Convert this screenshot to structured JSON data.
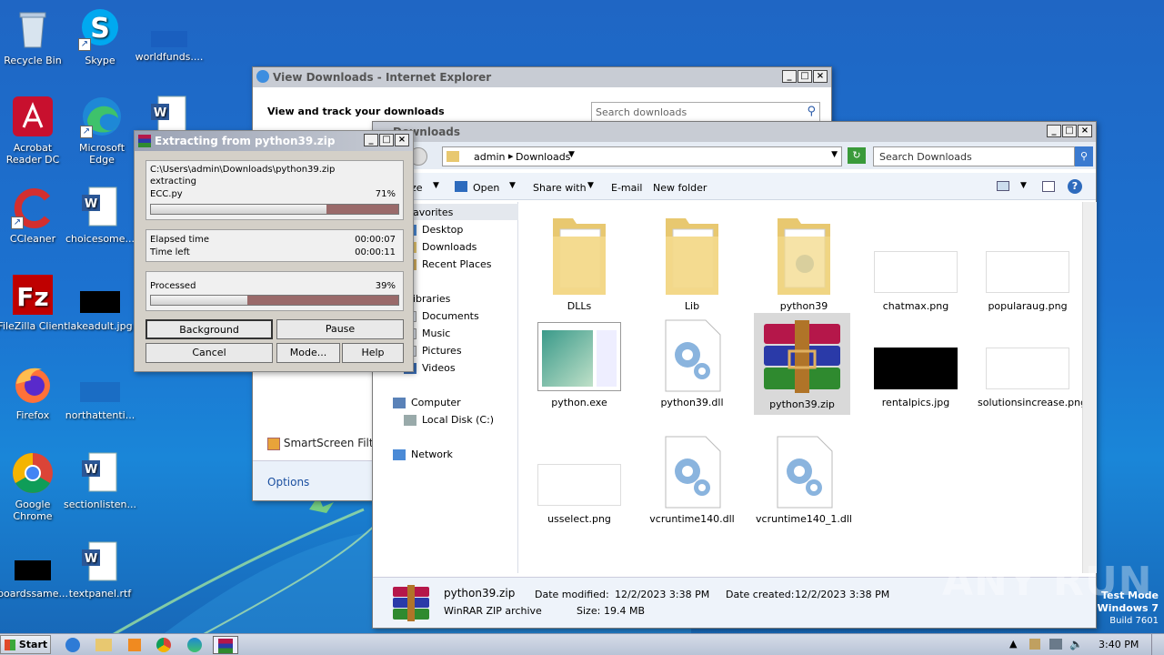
{
  "desktop": {
    "icons": [
      {
        "label": "Recycle Bin"
      },
      {
        "label": "Skype"
      },
      {
        "label": "worldfunds...."
      },
      {
        "label": "Acrobat Reader DC"
      },
      {
        "label": "Microsoft Edge"
      },
      {
        "label": "CCleaner"
      },
      {
        "label": "choicesome..."
      },
      {
        "label": "FileZilla Client"
      },
      {
        "label": "lakeadult.jpg"
      },
      {
        "label": "Firefox"
      },
      {
        "label": "northattenti..."
      },
      {
        "label": "Google Chrome"
      },
      {
        "label": "sectionlisten..."
      },
      {
        "label": "boardssame..."
      },
      {
        "label": "textpanel.rtf"
      }
    ]
  },
  "ie_window": {
    "title": "View Downloads - Internet Explorer",
    "heading": "View and track your downloads",
    "search_placeholder": "Search downloads",
    "smartscreen": "SmartScreen Filte",
    "options": "Options"
  },
  "explorer": {
    "title": "Downloads",
    "breadcrumb": [
      "admin",
      "Downloads"
    ],
    "search_placeholder": "Search Downloads",
    "toolbar": {
      "organize": "ze",
      "open": "Open",
      "share": "Share with",
      "email": "E-mail",
      "new_folder": "New folder"
    },
    "nav": {
      "favorites": "avorites",
      "desktop": "Desktop",
      "downloads": "Downloads",
      "recent": "Recent Places",
      "libraries": "ibraries",
      "documents": "Documents",
      "music": "Music",
      "pictures": "Pictures",
      "videos": "Videos",
      "computer": "Computer",
      "localdisk": "Local Disk (C:)",
      "network": "Network"
    },
    "files": [
      {
        "name": "DLLs"
      },
      {
        "name": "Lib"
      },
      {
        "name": "python39"
      },
      {
        "name": "chatmax.png"
      },
      {
        "name": "popularaug.png"
      },
      {
        "name": "python.exe"
      },
      {
        "name": "python39.dll"
      },
      {
        "name": "python39.zip"
      },
      {
        "name": "rentalpics.jpg"
      },
      {
        "name": "solutionsincrease.png"
      },
      {
        "name": "usselect.png"
      },
      {
        "name": "vcruntime140.dll"
      },
      {
        "name": "vcruntime140_1.dll"
      }
    ],
    "details": {
      "name": "python39.zip",
      "type": "WinRAR ZIP archive",
      "modified_label": "Date modified:",
      "modified": "12/2/2023 3:38 PM",
      "created_label": "Date created:",
      "created": "12/2/2023 3:38 PM",
      "size_label": "Size:",
      "size": "19.4 MB"
    }
  },
  "extract_dialog": {
    "title": "Extracting from python39.zip",
    "path": "C:\\Users\\admin\\Downloads\\python39.zip",
    "action": "extracting",
    "current_file": "ECC.py",
    "file_percent": "71%",
    "file_progress": 0.71,
    "elapsed_label": "Elapsed time",
    "elapsed": "00:00:07",
    "left_label": "Time left",
    "left": "00:00:11",
    "processed_label": "Processed",
    "processed_percent": "39%",
    "processed_progress": 0.39,
    "buttons": {
      "background": "Background",
      "pause": "Pause",
      "cancel": "Cancel",
      "mode": "Mode...",
      "help": "Help"
    }
  },
  "watermark": {
    "text": "ANY RUN"
  },
  "os": {
    "line1": "Test Mode",
    "line2": "Windows 7",
    "line3": "Build 7601"
  },
  "taskbar": {
    "start": "Start",
    "time": "3:40 PM"
  }
}
